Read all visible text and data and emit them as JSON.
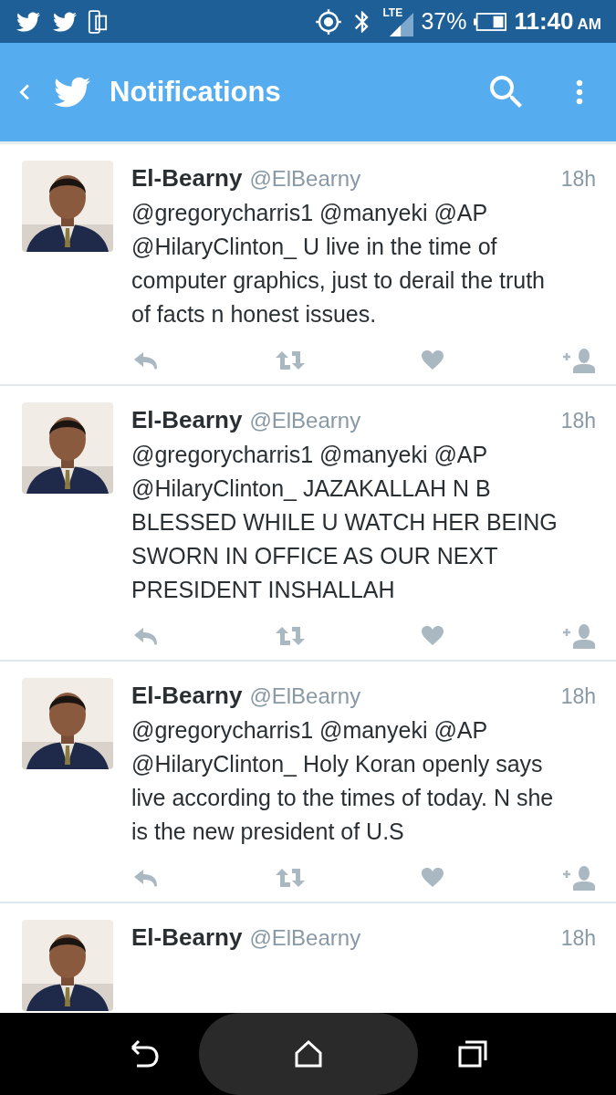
{
  "status_bar": {
    "network": "LTE",
    "battery": "37%",
    "time": "11:40",
    "period": "AM"
  },
  "app_bar": {
    "title": "Notifications"
  },
  "tweets": [
    {
      "name": "El-Bearny",
      "handle": "@ElBearny",
      "time": "18h",
      "text": "@gregorycharris1 @manyeki @AP @HilaryClinton_ U live in the time of computer graphics, just to derail the truth of facts n honest issues."
    },
    {
      "name": "El-Bearny",
      "handle": "@ElBearny",
      "time": "18h",
      "text": "@gregorycharris1 @manyeki @AP @HilaryClinton_ JAZAKALLAH N B BLESSED WHILE U WATCH HER BEING SWORN IN OFFICE AS OUR NEXT PRESIDENT INSHALLAH"
    },
    {
      "name": "El-Bearny",
      "handle": "@ElBearny",
      "time": "18h",
      "text": "@gregorycharris1 @manyeki @AP @HilaryClinton_ Holy Koran openly says live according to the times of today. N she is the new president of U.S"
    },
    {
      "name": "El-Bearny",
      "handle": "@ElBearny",
      "time": "18h"
    }
  ]
}
